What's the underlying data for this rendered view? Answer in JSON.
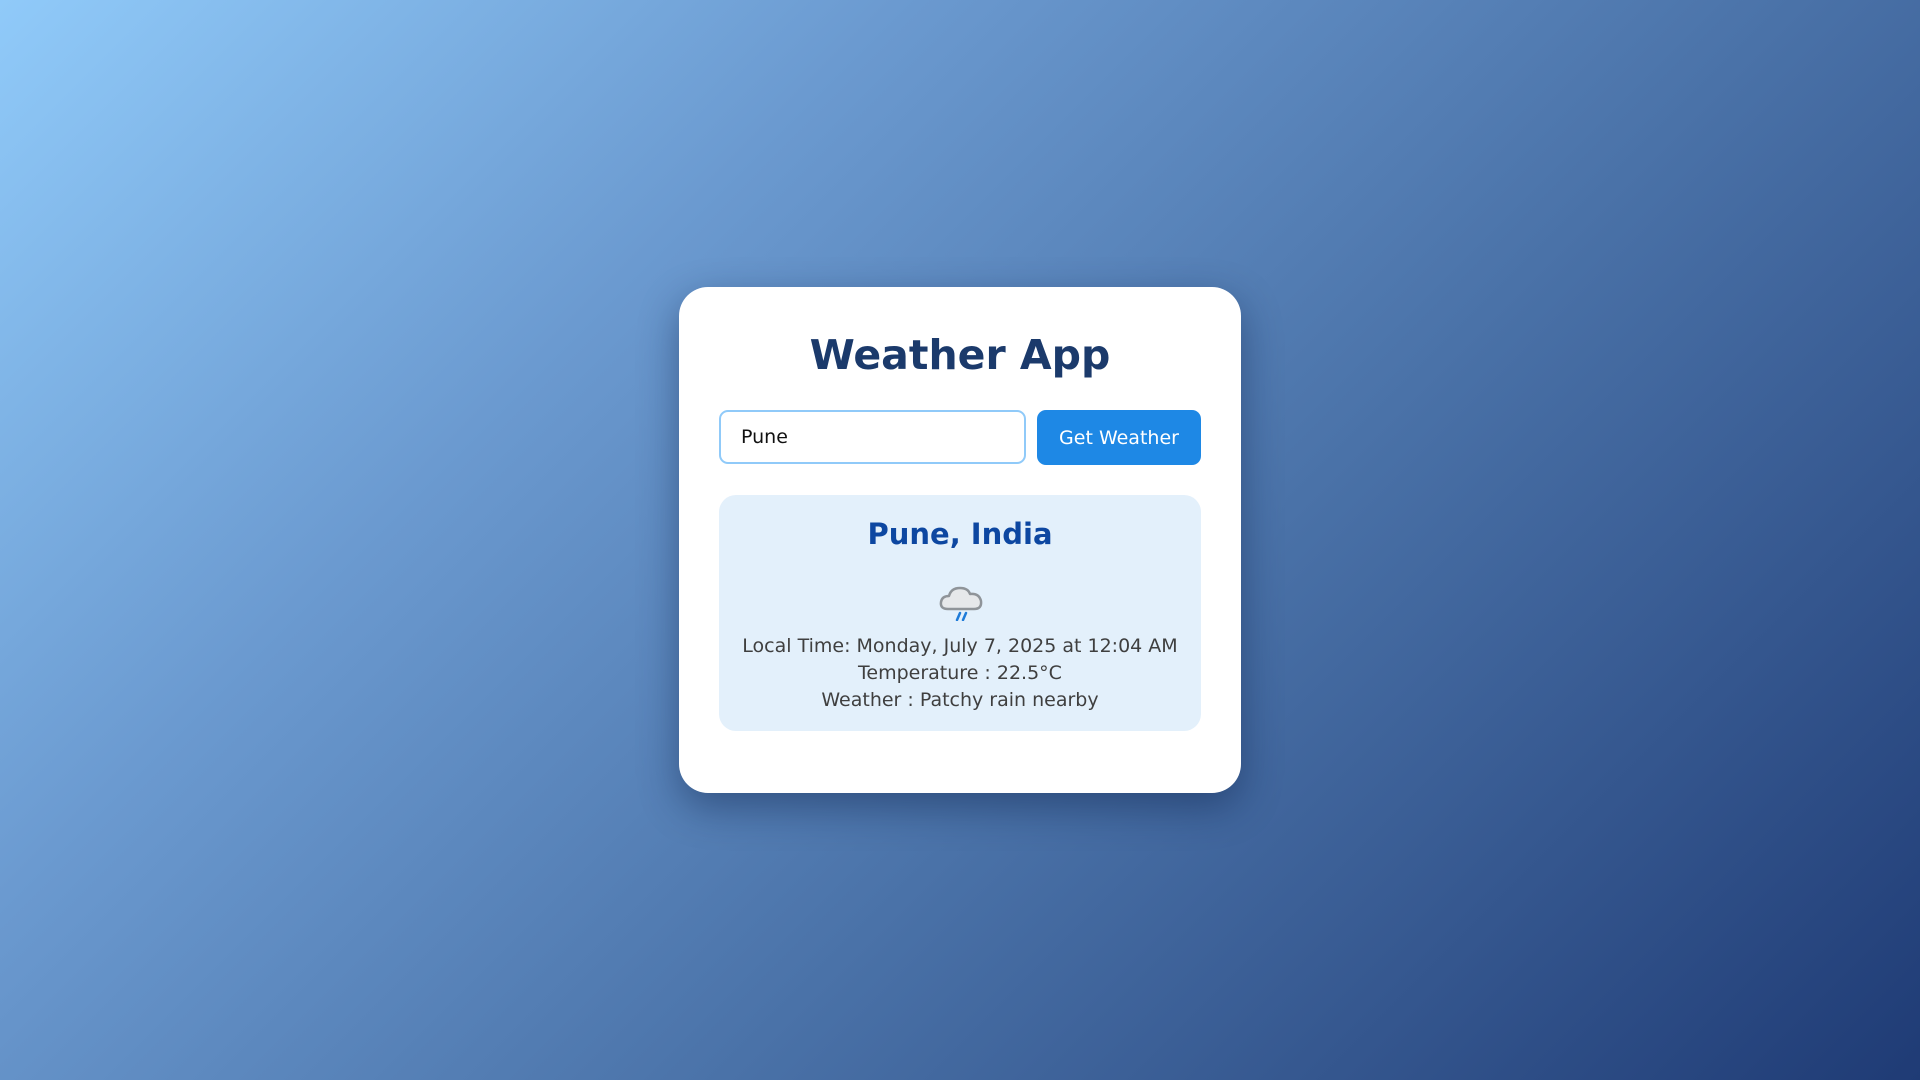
{
  "app": {
    "title": "Weather App"
  },
  "search": {
    "value": "Pune",
    "button_label": "Get Weather"
  },
  "result": {
    "location": "Pune, India",
    "icon": "moon-cloud-rain-icon",
    "local_time": "Local Time: Monday, July 7, 2025 at 12:04 AM",
    "temperature": "Temperature : 22.5°C",
    "condition": "Weather : Patchy rain nearby"
  },
  "colors": {
    "title": "#1b3a6b",
    "button": "#1e88e5",
    "location": "#0d47a1",
    "result_background": "#e3f0fb",
    "input_border": "#90caf9"
  }
}
